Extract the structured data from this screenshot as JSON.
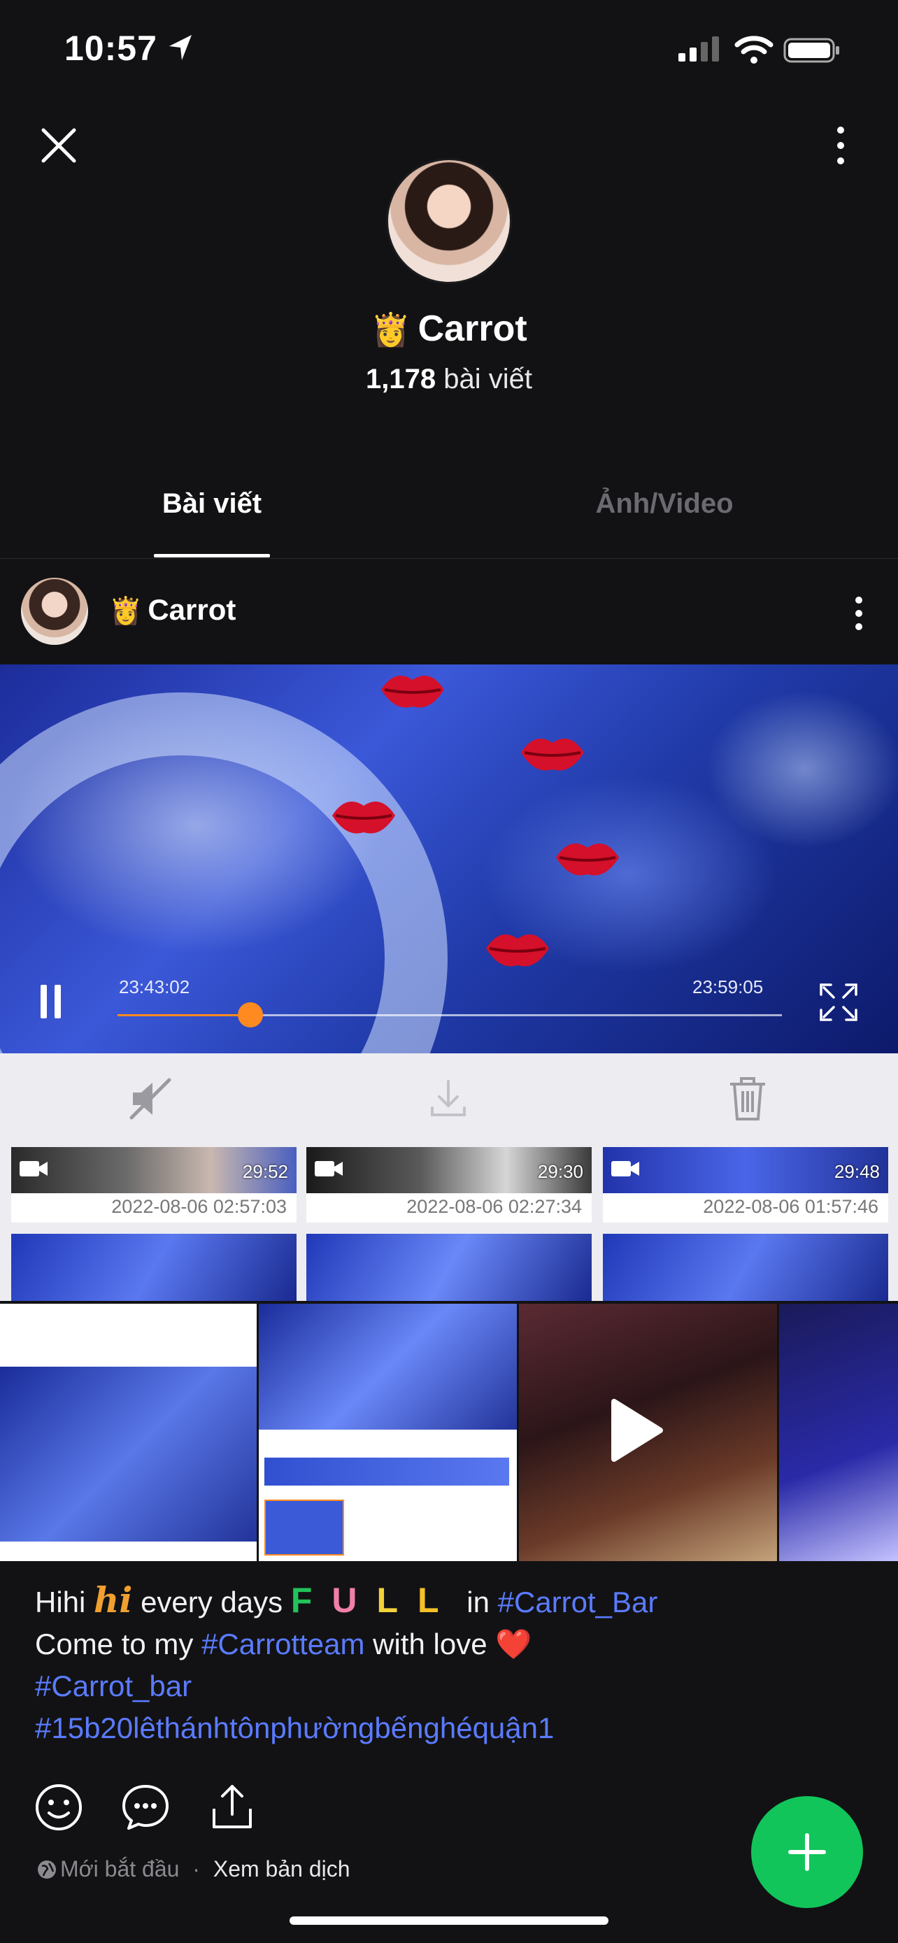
{
  "status": {
    "time": "10:57"
  },
  "profile": {
    "name": "Carrot",
    "crown": "👸",
    "post_count": "1,178",
    "post_count_suffix": "bài viết"
  },
  "tabs": [
    {
      "label": "Bài viết",
      "active": true
    },
    {
      "label": "Ảnh/Video",
      "active": false
    }
  ],
  "post": {
    "author": "Carrot",
    "crown": "👸",
    "video": {
      "time_current": "23:43:02",
      "time_end": "23:59:05",
      "progress": 0.2
    },
    "clips": [
      {
        "duration": "29:52",
        "date": "2022-08-06 02:57:03"
      },
      {
        "duration": "29:30",
        "date": "2022-08-06 02:27:34"
      },
      {
        "duration": "29:48",
        "date": "2022-08-06 01:57:46"
      }
    ],
    "caption": {
      "l1_a": "Hihi",
      "l1_hi": "hi",
      "l1_b": "every days",
      "l1_full": [
        "F",
        "U",
        "L",
        "L"
      ],
      "l1_c": "in",
      "l1_tag": "#Carrot_Bar",
      "l2_a": "Come to my",
      "l2_tag": "#Carrotteam",
      "l2_b": "with love",
      "l2_heart": "❤️",
      "l3_tag": "#Carrot_bar",
      "l4_tag": "#15b20lêthánhtônphườngbếnghéquận1"
    },
    "footer": {
      "status": "Mới bắt đầu",
      "separator": "·",
      "translate": "Xem bản dịch"
    }
  },
  "colors": {
    "accent_fab": "#12c55a",
    "hashtag": "#5b7bff",
    "progress": "#ff8a1f"
  }
}
